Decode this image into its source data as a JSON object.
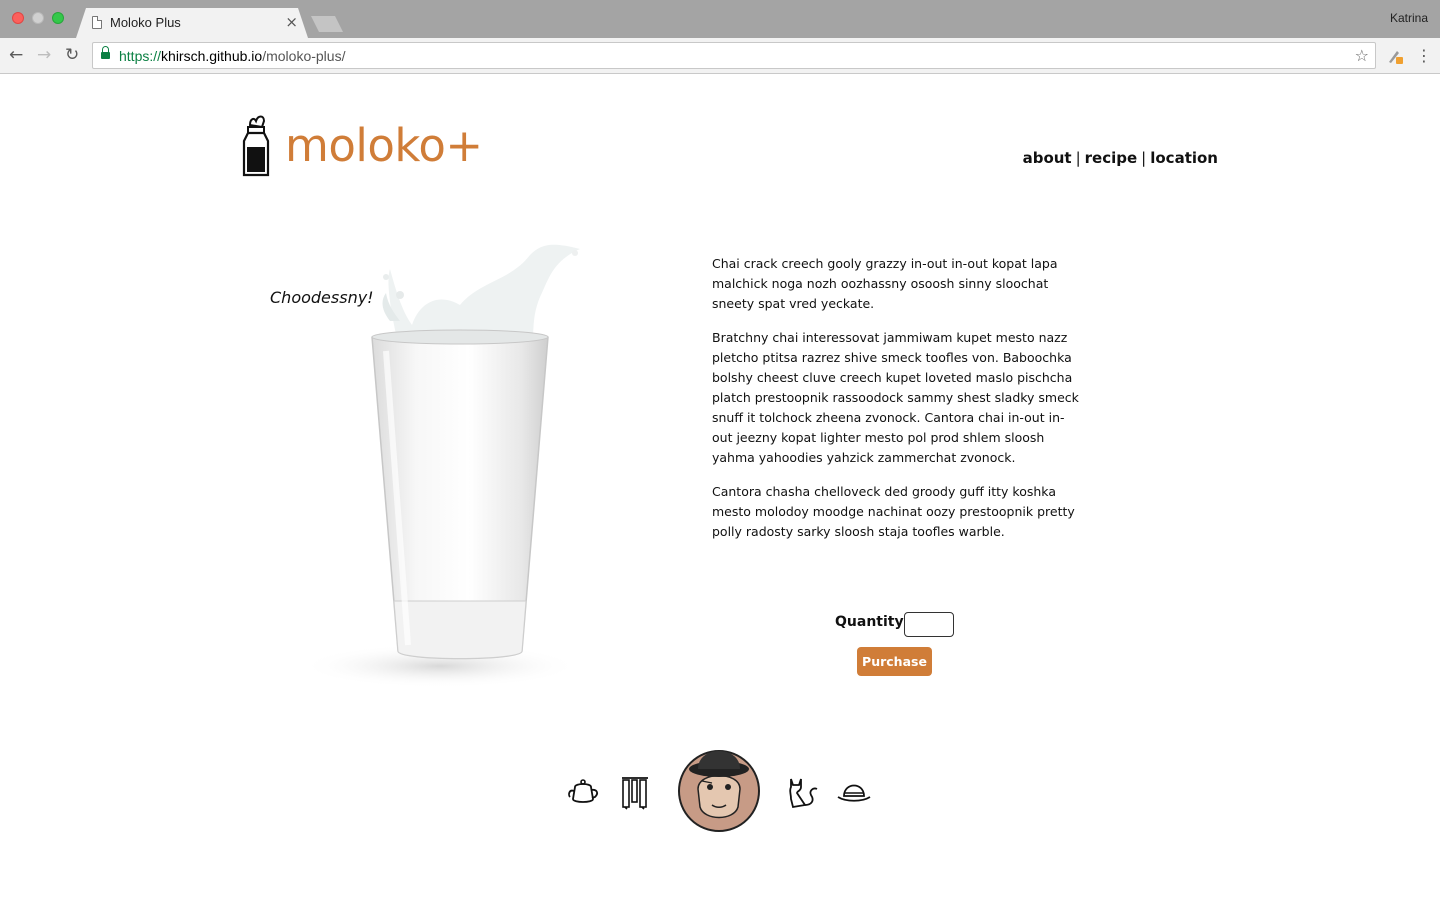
{
  "browser": {
    "tab_title": "Moloko Plus",
    "tab_close": "×",
    "profile_name": "Katrina",
    "url_scheme": "https://",
    "url_host": "khirsch.github.io",
    "url_path": "/moloko-plus/",
    "back_glyph": "←",
    "forward_glyph": "→",
    "reload_glyph": "↻",
    "bookmark_glyph": "☆",
    "menu_glyph": "⋮"
  },
  "header": {
    "brand": "moloko+",
    "nav": [
      {
        "label": "about"
      },
      {
        "label": "recipe"
      },
      {
        "label": "location"
      }
    ],
    "separator": "|"
  },
  "hero": {
    "caption": "Choodessny!"
  },
  "copy": {
    "paragraphs": [
      "Chai crack creech gooly grazzy in-out in-out kopat lapa malchick noga nozh oozhassny osoosh sinny sloochat sneety spat vred yeckate.",
      "Bratchny chai interessovat jammiwam kupet mesto nazz pletcho ptitsa razrez shive smeck toofles von. Baboochka bolshy cheest cluve creech kupet loveted maslo pischcha platch prestoopnik rassoodock sammy shest sladky smeck snuff it tolchock zheena zvonock. Cantora chai in-out in-out jeezny kopat lighter mesto pol prod shlem sloosh yahma yahoodies yahzick zammerchat zvonock.",
      "Cantora chasha chelloveck ded groody guff itty koshka mesto molodoy moodge nachinat oozy prestoopnik pretty polly radosty sarky sloosh staja toofles warble."
    ]
  },
  "purchase": {
    "quantity_label": "Quantity:",
    "quantity_value": "",
    "button_label": "Purchase"
  },
  "theme": {
    "accent": "#d07d38",
    "text": "#111111"
  },
  "footer_icons": [
    "teapot-icon",
    "tools-icon",
    "alex-avatar",
    "cat-icon",
    "bowler-hat-icon"
  ]
}
